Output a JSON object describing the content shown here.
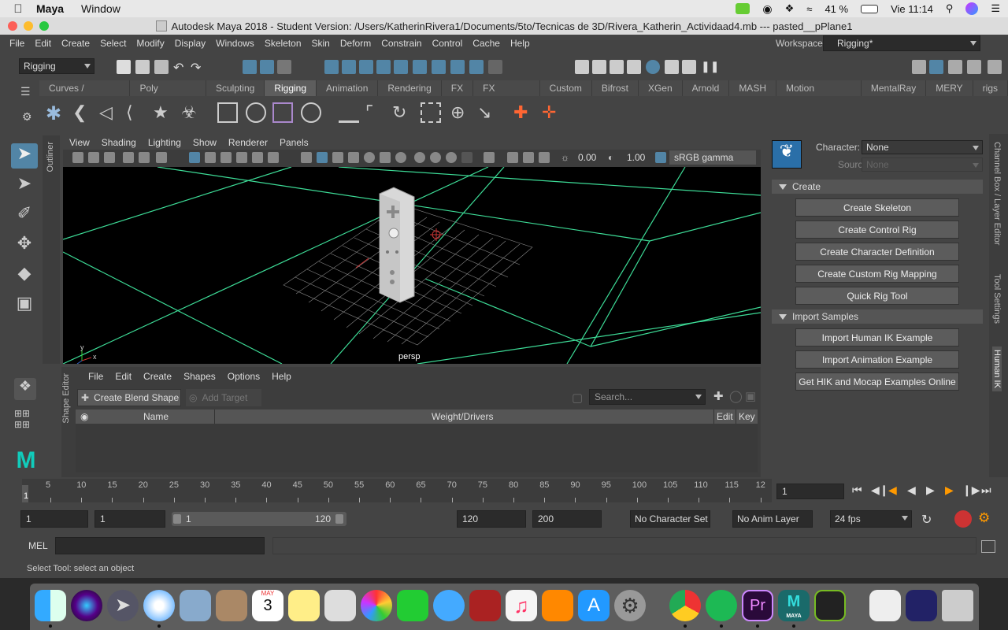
{
  "menubar": {
    "app_name": "Maya",
    "window_menu": "Window",
    "battery": "41 %",
    "clock": "Vie 11:14"
  },
  "window": {
    "title": "Autodesk Maya 2018 - Student Version: /Users/KatherinRivera1/Documents/5to/Tecnicas de 3D/Rivera_Katherin_Actividaad4.mb  ---  pasted__pPlane1"
  },
  "main_menu": [
    "File",
    "Edit",
    "Create",
    "Select",
    "Modify",
    "Display",
    "Windows",
    "Skeleton",
    "Skin",
    "Deform",
    "Constrain",
    "Control",
    "Cache",
    "Help"
  ],
  "workspace": {
    "label": "Workspace :",
    "value": "Rigging*"
  },
  "menu_set": "Rigging",
  "shelf_tabs": [
    "Curves / Surfaces",
    "Poly Modeling",
    "Sculpting",
    "Rigging",
    "Animation",
    "Rendering",
    "FX",
    "FX Caching",
    "Custom",
    "Bifrost",
    "XGen",
    "Arnold",
    "MASH",
    "Motion Graphics",
    "MentalRay",
    "MERY",
    "rigs"
  ],
  "active_shelf": "Rigging",
  "viewport": {
    "menus": [
      "View",
      "Shading",
      "Lighting",
      "Show",
      "Renderer",
      "Panels"
    ],
    "near": "0.00",
    "far": "1.00",
    "color_space": "sRGB gamma",
    "camera_label": "persp",
    "axis_y": "y",
    "axis_x": "x"
  },
  "side_tabs": {
    "outliner": "Outliner",
    "shape_editor": "Shape Editor",
    "channel_box": "Channel Box / Layer Editor",
    "tool_settings": "Tool Settings",
    "human_ik": "Human IK"
  },
  "shape_editor": {
    "menus": [
      "File",
      "Edit",
      "Create",
      "Shapes",
      "Options",
      "Help"
    ],
    "create_blend_shape": "Create Blend Shape",
    "add_target": "Add Target",
    "search_placeholder": "Search...",
    "columns": {
      "name": "Name",
      "weight": "Weight/Drivers",
      "edit": "Edit",
      "key": "Key"
    }
  },
  "human_ik": {
    "character_label": "Character:",
    "character_value": "None",
    "source_label": "Source:",
    "source_value": "None",
    "create_section": "Create",
    "create_buttons": [
      "Create Skeleton",
      "Create Control Rig",
      "Create Character Definition",
      "Create Custom Rig Mapping",
      "Quick Rig Tool"
    ],
    "import_section": "Import Samples",
    "import_buttons": [
      "Import Human IK Example",
      "Import Animation Example",
      "Get HIK and Mocap Examples Online"
    ]
  },
  "time_slider": {
    "ticks": [
      "5",
      "10",
      "15",
      "20",
      "25",
      "30",
      "35",
      "40",
      "45",
      "50",
      "55",
      "60",
      "65",
      "70",
      "75",
      "80",
      "85",
      "90",
      "95",
      "100",
      "105",
      "110",
      "115",
      "12"
    ],
    "current_frame_marker": "1",
    "current_frame": "1"
  },
  "range": {
    "start": "1",
    "anim_start": "1",
    "slider_start": "1",
    "slider_end": "120",
    "playback_end": "120",
    "anim_end": "200",
    "character_set": "No Character Set",
    "anim_layer": "No Anim Layer",
    "fps": "24 fps"
  },
  "command_line": {
    "mode": "MEL"
  },
  "help_line": "Select Tool: select an object",
  "dock": {
    "calendar_month": "MAY",
    "calendar_day": "3",
    "maya_label": "MAYA"
  },
  "colors": {
    "grid_green": "#3ddc97",
    "viewport_bg": "#000000",
    "accent_blue": "#5285a6"
  }
}
